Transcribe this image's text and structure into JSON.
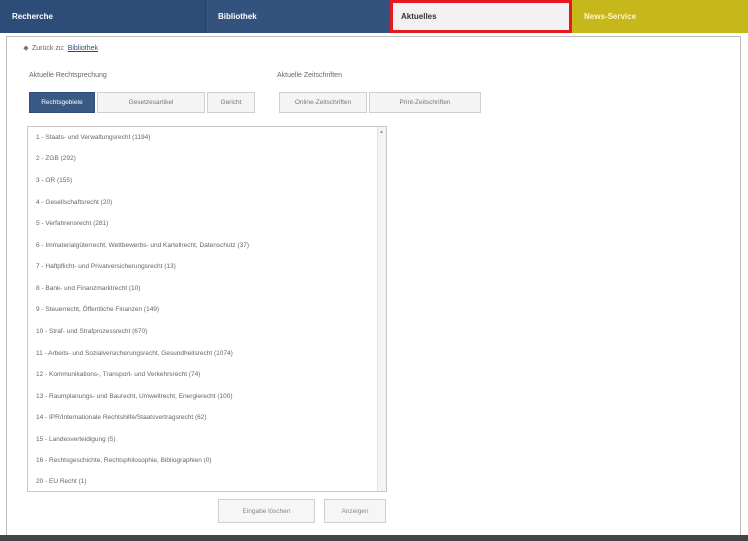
{
  "nav": {
    "tabs": [
      {
        "label": "Recherche"
      },
      {
        "label": "Bibliothek"
      },
      {
        "label": "Aktuelles"
      },
      {
        "label": "News-Service"
      }
    ]
  },
  "breadcrumb": {
    "prefix": "Zurück zu:",
    "link": "Bibliothek"
  },
  "rechtsprechung": {
    "label": "Aktuelle Rechtsprechung",
    "buttons": [
      {
        "label": "Rechtsgebiete"
      },
      {
        "label": "Gesetzesartikel"
      },
      {
        "label": "Gericht"
      }
    ]
  },
  "zeitschriften": {
    "label": "Aktuelle Zeitschriften",
    "buttons": [
      {
        "label": "Online-Zeitschriften"
      },
      {
        "label": "Print-Zeitschriften"
      }
    ]
  },
  "list": {
    "items": [
      "1 - Staats- und Verwaltungsrecht (1194)",
      "2 - ZGB (292)",
      "3 - OR (155)",
      "4 - Gesellschaftsrecht (20)",
      "5 - Verfahrensrecht (281)",
      "6 - Immaterialgüterrecht, Wettbewerbs- und Kartellrecht, Datenschutz (37)",
      "7 - Haftpflicht- und Privatversicherungsrecht (13)",
      "8 - Bank- und Finanzmarktrecht (10)",
      "9 - Steuerrecht, Öffentliche Finanzen (149)",
      "10 - Straf- und Strafprozessrecht (670)",
      "11 - Arbeits- und Sozialversicherungsrecht, Gesundheitsrecht (1074)",
      "12 - Kommunikations-, Transport- und Verkehrsrecht (74)",
      "13 - Raumplanungs- und Baurecht, Umweltrecht, Energierecht (100)",
      "14 - IPR/Internationale Rechtshilfe/Staatsvertragsrecht (62)",
      "15 - Landesverteidigung (5)",
      "16 - Rechtsgeschichte, Rechtsphilosophie, Bibliographien (0)",
      "20 - EU Recht (1)"
    ]
  },
  "actions": {
    "clear": "Eingabe löschen",
    "show": "Anzeigen"
  },
  "colors": {
    "nav_blue": "#2e4c78",
    "nav_yellow": "#c6b71a",
    "highlight_red": "#e5191f"
  }
}
